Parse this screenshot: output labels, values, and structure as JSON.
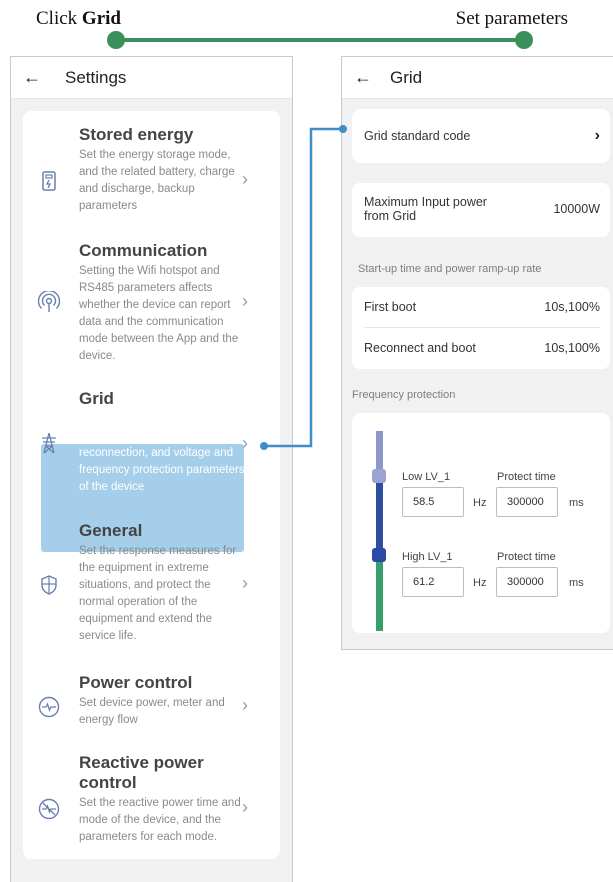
{
  "steps": {
    "step1_prefix": "Click ",
    "step1_bold": "Grid",
    "step2": "Set parameters"
  },
  "colors": {
    "step_green": "#3a8f5c",
    "highlight_blue": "#a4cee9",
    "connector_blue": "#3f8dc9"
  },
  "settings": {
    "back_icon": "arrow-left-icon",
    "title": "Settings",
    "items": [
      {
        "icon": "battery-icon",
        "title": "Stored energy",
        "desc": "Set the energy storage mode, and the related battery, charge and discharge, backup parameters"
      },
      {
        "icon": "signal-icon",
        "title": "Communication",
        "desc": "Setting the Wifi hotspot and RS485 parameters affects whether the device can report data and the communication mode between the App and the device."
      },
      {
        "icon": "power-tower-icon",
        "title": "Grid",
        "desc": "Set the power grid standard code, power-on and reconnection, and voltage and frequency protection parameters of the device"
      },
      {
        "icon": "shield-icon",
        "title": "General",
        "desc": "Set the response measures for the equipment in extreme situations, and protect the normal operation of the equipment and extend the service life."
      },
      {
        "icon": "pulse-icon",
        "title": "Power control",
        "desc": "Set device power, meter and energy flow"
      },
      {
        "icon": "reactive-power-icon",
        "title": "Reactive power control",
        "desc": "Set the reactive power time and mode of the device, and the parameters for each mode."
      }
    ]
  },
  "grid": {
    "title": "Grid",
    "standard_code_label": "Grid standard code",
    "max_input_label": "Maximum Input power from Grid",
    "max_input_value": "10000W",
    "startup_section": "Start-up time and power ramp-up rate",
    "first_boot_label": "First boot",
    "first_boot_value": "10s,100%",
    "reconnect_label": "Reconnect and boot",
    "reconnect_value": "10s,100%",
    "freq_section": "Frequency protection",
    "low": {
      "label": "Low LV_1",
      "protect_label": "Protect time",
      "value": "58.5",
      "unit": "Hz",
      "time": "300000",
      "time_unit": "ms"
    },
    "high": {
      "label": "High LV_1",
      "protect_label": "Protect time",
      "value": "61.2",
      "unit": "Hz",
      "time": "300000",
      "time_unit": "ms"
    }
  }
}
